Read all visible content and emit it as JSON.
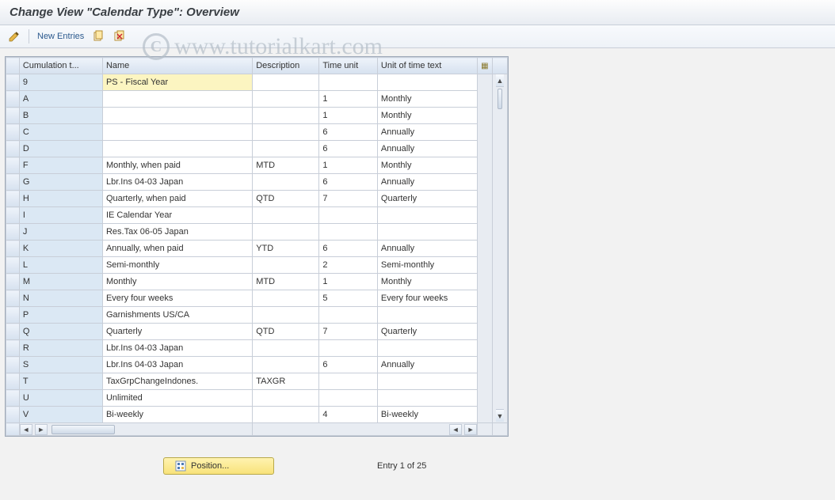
{
  "title": "Change View \"Calendar Type\": Overview",
  "toolbar": {
    "new_entries_label": "New Entries"
  },
  "watermark": "www.tutorialkart.com",
  "columns": {
    "cumulation": "Cumulation t...",
    "name": "Name",
    "description": "Description",
    "time_unit": "Time unit",
    "unit_text": "Unit of time text"
  },
  "rows": [
    {
      "key": "9",
      "name": "PS - Fiscal Year",
      "desc": "",
      "time": "",
      "unit": "",
      "selected": true
    },
    {
      "key": "A",
      "name": "",
      "desc": "",
      "time": "1",
      "unit": "Monthly"
    },
    {
      "key": "B",
      "name": "",
      "desc": "",
      "time": "1",
      "unit": "Monthly"
    },
    {
      "key": "C",
      "name": "",
      "desc": "",
      "time": "6",
      "unit": "Annually"
    },
    {
      "key": "D",
      "name": "",
      "desc": "",
      "time": "6",
      "unit": "Annually"
    },
    {
      "key": "F",
      "name": "Monthly, when paid",
      "desc": "MTD",
      "time": "1",
      "unit": "Monthly"
    },
    {
      "key": "G",
      "name": "Lbr.Ins 04-03  Japan",
      "desc": "",
      "time": "6",
      "unit": "Annually"
    },
    {
      "key": "H",
      "name": "Quarterly, when paid",
      "desc": "QTD",
      "time": "7",
      "unit": "Quarterly"
    },
    {
      "key": "I",
      "name": "IE Calendar Year",
      "desc": "",
      "time": "",
      "unit": ""
    },
    {
      "key": "J",
      "name": "Res.Tax 06-05  Japan",
      "desc": "",
      "time": "",
      "unit": ""
    },
    {
      "key": "K",
      "name": "Annually, when paid",
      "desc": "YTD",
      "time": "6",
      "unit": "Annually"
    },
    {
      "key": "L",
      "name": "Semi-monthly",
      "desc": "",
      "time": "2",
      "unit": "Semi-monthly"
    },
    {
      "key": "M",
      "name": "Monthly",
      "desc": "MTD",
      "time": "1",
      "unit": "Monthly"
    },
    {
      "key": "N",
      "name": "Every four weeks",
      "desc": "",
      "time": "5",
      "unit": "Every four weeks"
    },
    {
      "key": "P",
      "name": "Garnishments US/CA",
      "desc": "",
      "time": "",
      "unit": ""
    },
    {
      "key": "Q",
      "name": "Quarterly",
      "desc": "QTD",
      "time": "7",
      "unit": "Quarterly"
    },
    {
      "key": "R",
      "name": "Lbr.Ins 04-03  Japan",
      "desc": "",
      "time": "",
      "unit": ""
    },
    {
      "key": "S",
      "name": "Lbr.Ins 04-03  Japan",
      "desc": "",
      "time": "6",
      "unit": "Annually"
    },
    {
      "key": "T",
      "name": "TaxGrpChangeIndones.",
      "desc": "TAXGR",
      "time": "",
      "unit": ""
    },
    {
      "key": "U",
      "name": "Unlimited",
      "desc": "",
      "time": "",
      "unit": ""
    },
    {
      "key": "V",
      "name": "Bi-weekly",
      "desc": "",
      "time": "4",
      "unit": "Bi-weekly"
    }
  ],
  "footer": {
    "position_label": "Position...",
    "entry_text": "Entry 1 of 25"
  },
  "icons": {
    "pencil": "pencil-icon",
    "copy": "copy-icon",
    "delete": "delete-icon",
    "config": "config-icon",
    "pos": "position-icon"
  }
}
